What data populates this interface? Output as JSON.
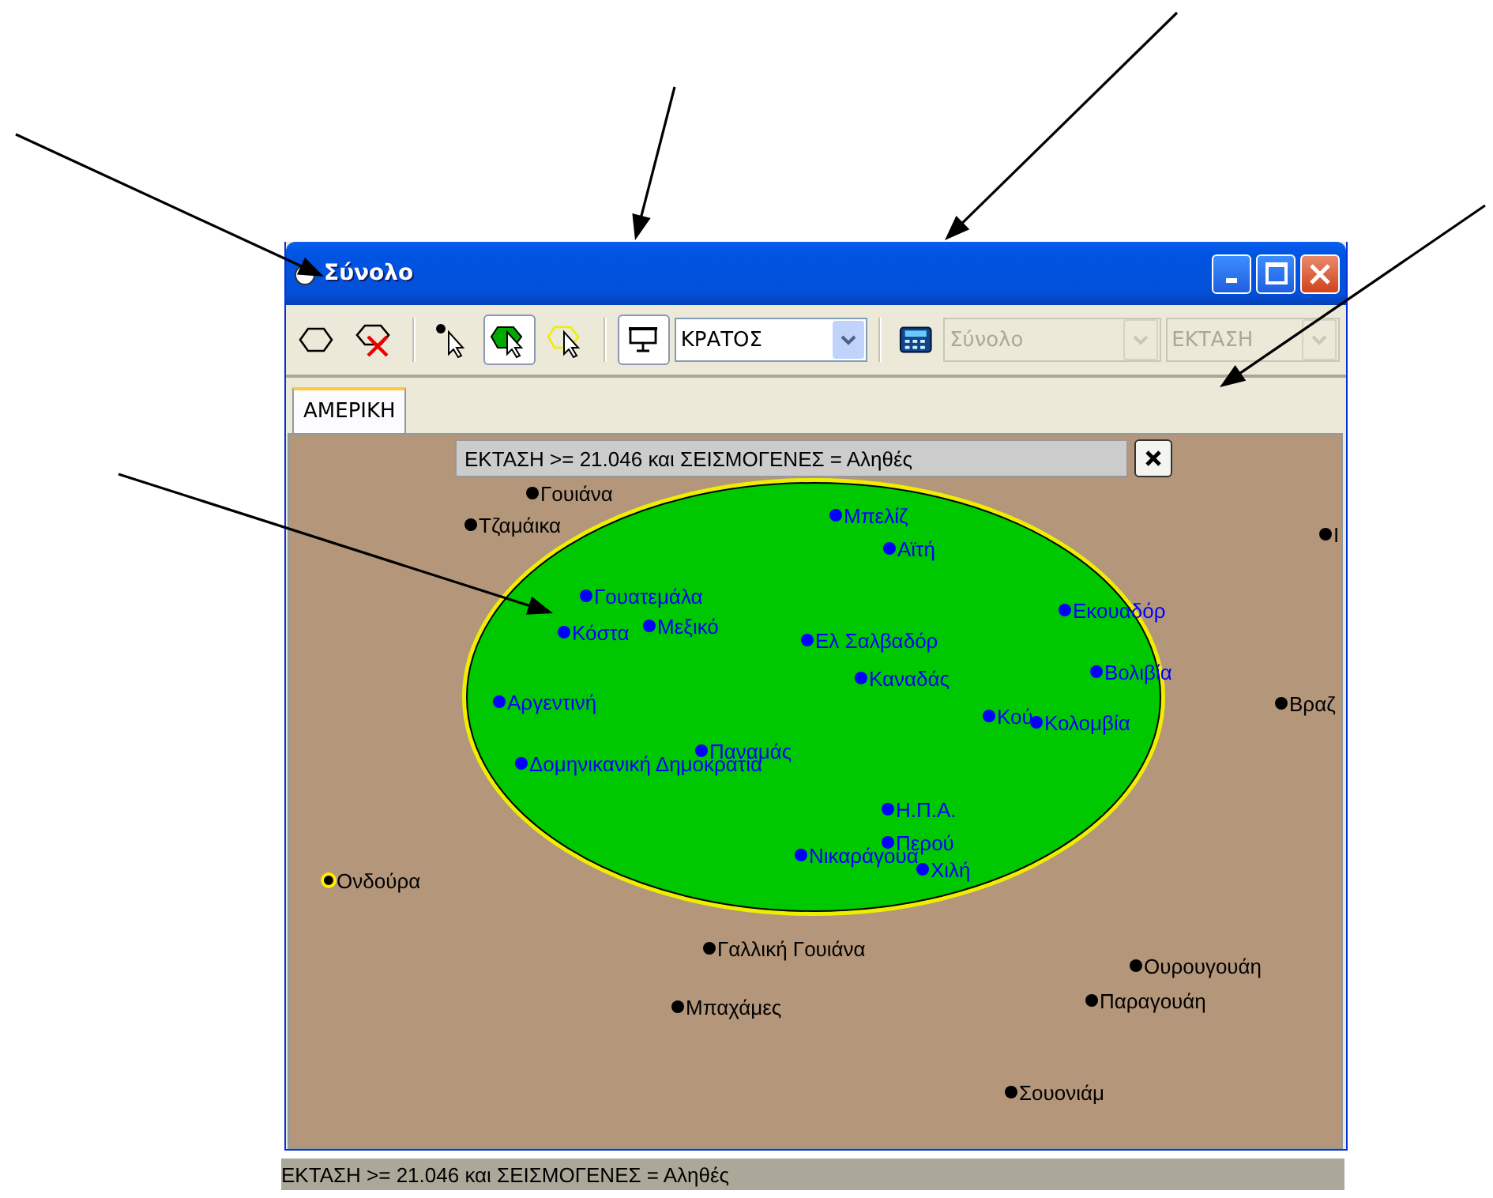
{
  "window": {
    "title": "Σύνολο"
  },
  "toolbar": {
    "tools": [
      {
        "kind": "ellipse",
        "pressed": false
      },
      {
        "kind": "ellipse_delete",
        "pressed": false
      },
      {
        "kind": "point_select",
        "pressed": false
      },
      {
        "kind": "region_select",
        "pressed": true
      },
      {
        "kind": "circle_select",
        "pressed": false
      }
    ],
    "display_button": {
      "pressed": true
    },
    "layer_combo": {
      "value": "ΚΡΑΤΟΣ",
      "disabled": false
    },
    "aggregate_combo": {
      "value": "Σύνολο",
      "disabled": true
    },
    "field_combo": {
      "value": "ΕΚΤΑΣΗ",
      "disabled": true
    }
  },
  "tabs": [
    {
      "label": "ΑΜΕΡΙΚΗ",
      "selected": true
    }
  ],
  "map": {
    "query": "ΕΚΤΑΣΗ >= 21.046 και ΣΕΙΣΜΟΓΕΝΕΣ = Αληθές",
    "points": [
      {
        "label": "Γουιάνα",
        "in_selection": false,
        "highlighted": false
      },
      {
        "label": "Τζαμάικα",
        "in_selection": false,
        "highlighted": false
      },
      {
        "label": "Μπελίζ",
        "in_selection": true,
        "highlighted": false
      },
      {
        "label": "Αϊτή",
        "in_selection": true,
        "highlighted": false
      },
      {
        "label": "Γουατεμάλα",
        "in_selection": true,
        "highlighted": false
      },
      {
        "label": "Κόστα",
        "in_selection": true,
        "highlighted": false
      },
      {
        "label": "Μεξικό",
        "in_selection": true,
        "highlighted": false
      },
      {
        "label": "Ελ Σαλβαδόρ",
        "in_selection": true,
        "highlighted": false
      },
      {
        "label": "Εκουαδόρ",
        "in_selection": true,
        "highlighted": false
      },
      {
        "label": "Καναδάς",
        "in_selection": true,
        "highlighted": false
      },
      {
        "label": "Βολιβία",
        "in_selection": true,
        "highlighted": false
      },
      {
        "label": "Αργεντινή",
        "in_selection": true,
        "highlighted": false
      },
      {
        "label": "Κού",
        "in_selection": true,
        "highlighted": false
      },
      {
        "label": "Κολομβία",
        "in_selection": true,
        "highlighted": false
      },
      {
        "label": "Παναμάς",
        "in_selection": true,
        "highlighted": false
      },
      {
        "label": "Δομηνικανική Δημοκρατία",
        "in_selection": true,
        "highlighted": false
      },
      {
        "label": "Η.Π.Α.",
        "in_selection": true,
        "highlighted": false
      },
      {
        "label": "Περού",
        "in_selection": true,
        "highlighted": false
      },
      {
        "label": "Νικαράγουα",
        "in_selection": true,
        "highlighted": false
      },
      {
        "label": "Χιλή",
        "in_selection": true,
        "highlighted": false
      },
      {
        "label": "Ονδούρα",
        "in_selection": false,
        "highlighted": true
      },
      {
        "label": "Γαλλική Γουιάνα",
        "in_selection": false,
        "highlighted": false
      },
      {
        "label": "Ουρουγουάη",
        "in_selection": false,
        "highlighted": false
      },
      {
        "label": "Μπαχάμες",
        "in_selection": false,
        "highlighted": false
      },
      {
        "label": "Παραγουάη",
        "in_selection": false,
        "highlighted": false
      },
      {
        "label": "Σουονιάμ",
        "in_selection": false,
        "highlighted": false
      },
      {
        "label": "Ι",
        "in_selection": false,
        "highlighted": false
      },
      {
        "label": "Βραζ",
        "in_selection": false,
        "highlighted": false
      }
    ]
  },
  "status_bar": {
    "text": "ΕΚΤΑΣΗ >= 21.046 και ΣΕΙΣΜΟΓΕΝΕΣ = Αληθές"
  }
}
